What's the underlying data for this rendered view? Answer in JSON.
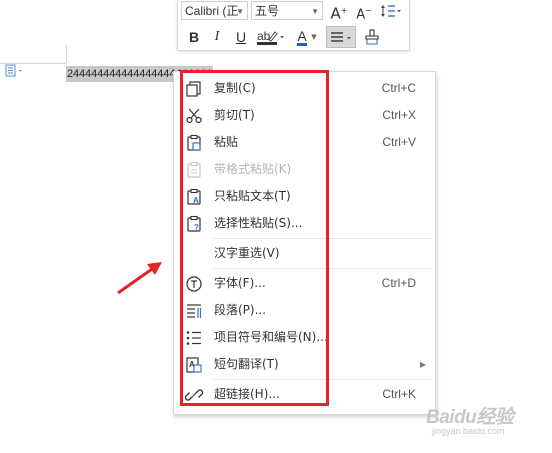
{
  "toolbar": {
    "font_name": "Calibri (正",
    "font_size": "五号",
    "grow_font": "A",
    "shrink_font": "A",
    "bold": "B",
    "italic": "I",
    "underline": "U",
    "font_color": "A"
  },
  "document": {
    "selected_text": "244444444444444444444444"
  },
  "menu": {
    "items": [
      {
        "label": "复制(C)",
        "shortcut": "Ctrl+C",
        "icon": "copy-icon"
      },
      {
        "label": "剪切(T)",
        "shortcut": "Ctrl+X",
        "icon": "scissors-icon"
      },
      {
        "label": "粘贴",
        "shortcut": "Ctrl+V",
        "icon": "paste-icon"
      },
      {
        "label": "带格式粘贴(K)",
        "shortcut": "",
        "icon": "paste-format-icon",
        "disabled": true
      },
      {
        "label": "只粘贴文本(T)",
        "shortcut": "",
        "icon": "paste-text-icon"
      },
      {
        "label": "选择性粘贴(S)...",
        "shortcut": "",
        "icon": "paste-special-icon"
      },
      {
        "label": "汉字重选(V)",
        "shortcut": "",
        "icon": ""
      },
      {
        "label": "字体(F)...",
        "shortcut": "Ctrl+D",
        "icon": "font-icon"
      },
      {
        "label": "段落(P)...",
        "shortcut": "",
        "icon": "paragraph-icon"
      },
      {
        "label": "项目符号和编号(N)...",
        "shortcut": "",
        "icon": "bullets-icon"
      },
      {
        "label": "短句翻译(T)",
        "shortcut": "",
        "icon": "translate-icon",
        "submenu": true
      },
      {
        "label": "超链接(H)...",
        "shortcut": "Ctrl+K",
        "icon": "hyperlink-icon"
      }
    ]
  },
  "watermark": {
    "logo": "Baidu经验",
    "url": "jingyan.baidu.com"
  },
  "colors": {
    "highlight_border": "#e8222a",
    "font_color_bar": "#1a5fd0"
  }
}
